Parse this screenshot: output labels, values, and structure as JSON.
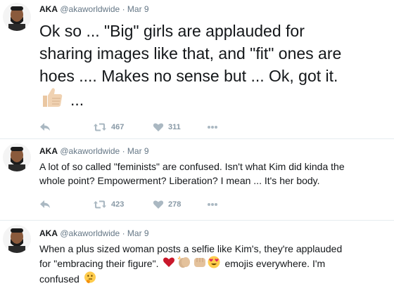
{
  "tweets": [
    {
      "name": "AKA",
      "handle": "@akaworldwide",
      "separator": "·",
      "time": "Mar 9",
      "text_line1": "Ok so ... \"Big\" girls are applauded for",
      "text_line2": "sharing images like that, and \"fit\" ones are",
      "text_line3": "hoes .... Makes no sense but ... Ok, got it.",
      "text_after_emoji": "...",
      "emoji": [
        "thumbs-up"
      ],
      "retweets": "467",
      "likes": "311"
    },
    {
      "name": "AKA",
      "handle": "@akaworldwide",
      "separator": "·",
      "time": "Mar 9",
      "text_line1": "A lot of so called \"feminists\" are confused. Isn't what Kim did kinda the",
      "text_line2": "whole point? Empowerment? Liberation? I mean ... It's her body.",
      "retweets": "423",
      "likes": "278"
    },
    {
      "name": "AKA",
      "handle": "@akaworldwide",
      "separator": "·",
      "time": "Mar 9",
      "text_line1": "When a plus sized woman posts a selfie like Kim's, they're applauded",
      "text_line2_pre": "for \"embracing their figure\".",
      "text_line2_post": "emojis everywhere. I'm",
      "text_line3": "confused",
      "emoji": [
        "red-heart",
        "clapping-hands",
        "oncoming-fist",
        "heart-eyes-face",
        "thinking-face"
      ]
    }
  ],
  "colors": {
    "name": "#14171a",
    "meta": "#657786",
    "action_icon": "#aab8c2",
    "divider": "#e6ecf0",
    "heart_emoji": "#c9182b",
    "emoji_face": "#ffcc4d"
  }
}
